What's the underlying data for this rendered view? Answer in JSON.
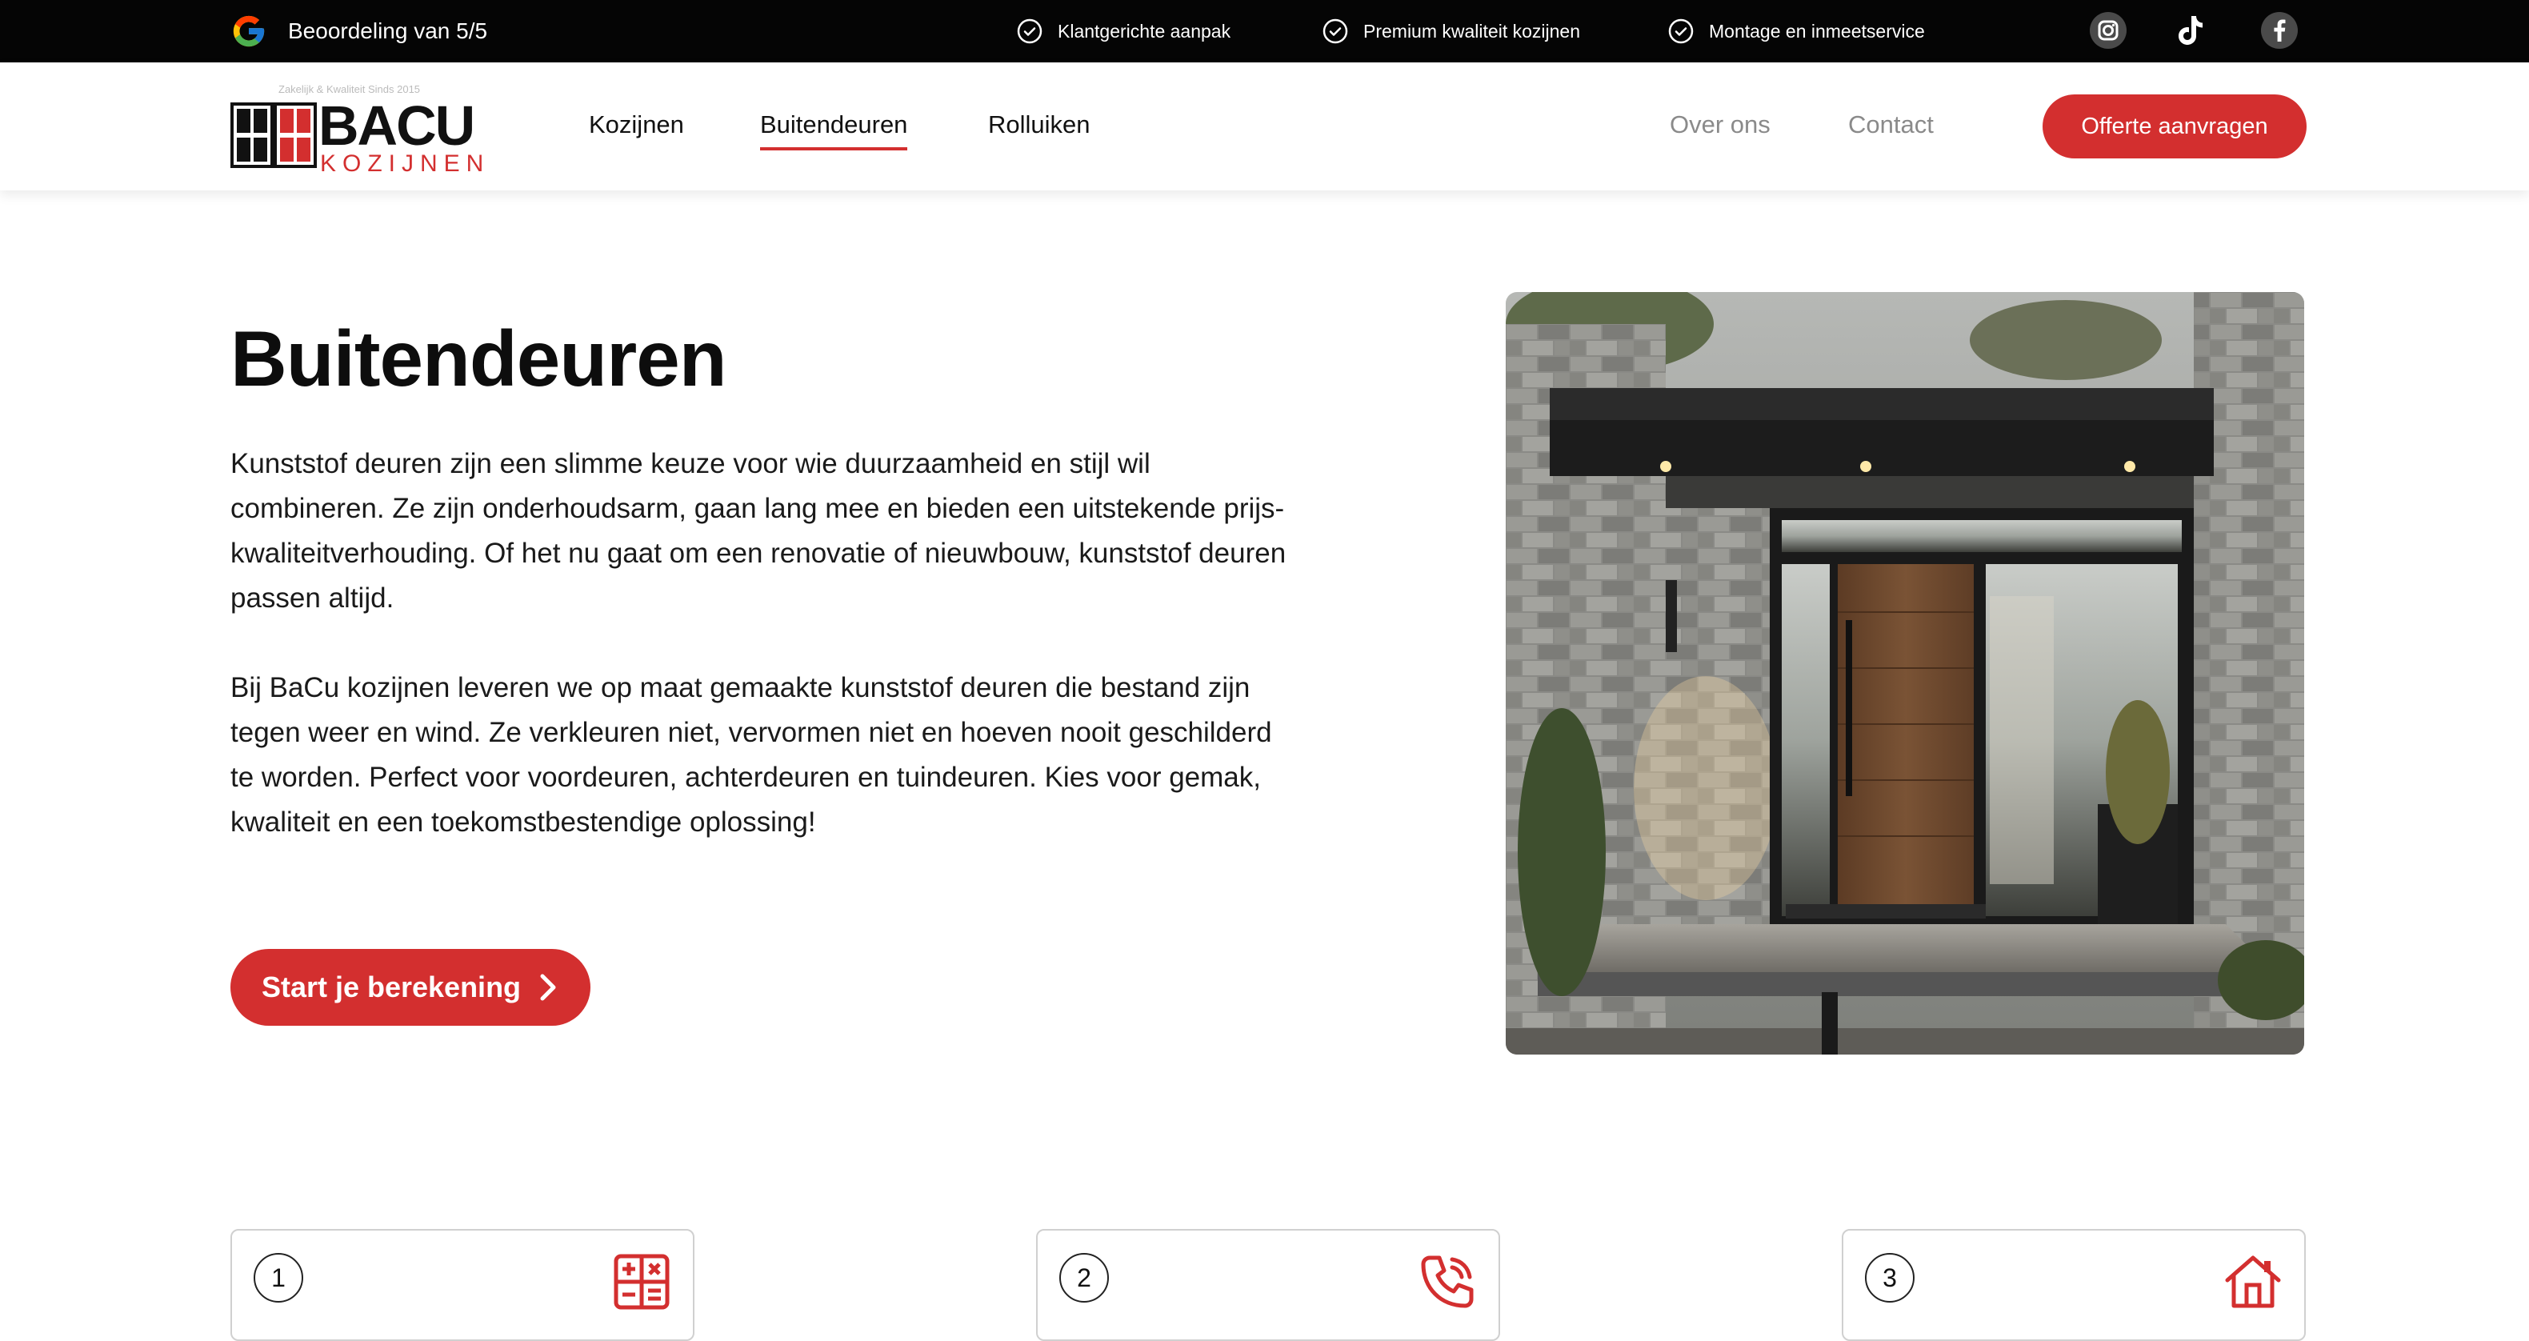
{
  "topbar": {
    "rating_text": "Beoordeling van 5/5",
    "usps": [
      "Klantgerichte aanpak",
      "Premium kwaliteit kozijnen",
      "Montage en inmeetservice"
    ],
    "socials": [
      "instagram-icon",
      "tiktok-icon",
      "facebook-icon"
    ]
  },
  "header": {
    "logo_tagline": "Zakelijk & Kwaliteit Sinds 2015",
    "logo_main": "BACU",
    "logo_sub": "KOZIJNEN",
    "nav": [
      "Kozijnen",
      "Buitendeuren",
      "Rolluiken"
    ],
    "nav_active": "Buitendeuren",
    "nav_right": [
      "Over ons",
      "Contact"
    ],
    "cta": "Offerte aanvragen"
  },
  "hero": {
    "title": "Buitendeuren",
    "paragraph1": "Kunststof deuren zijn een slimme keuze voor wie duurzaamheid en stijl wil combineren. Ze zijn onderhoudsarm, gaan lang mee en bieden een uitstekende prijs-kwaliteitverhouding. Of het nu gaat om een renovatie of nieuwbouw, kunststof deuren passen altijd.",
    "paragraph2": "Bij BaCu kozijnen leveren we op maat gemaakte kunststof deuren die bestand zijn tegen weer en wind. Ze verkleuren niet, vervormen niet en hoeven nooit geschilderd te worden. Perfect voor voordeuren, achterdeuren en tuindeuren. Kies voor gemak, kwaliteit en een toekomstbestendige oplossing!",
    "button": "Start je berekening"
  },
  "steps": [
    {
      "number": "1",
      "icon": "calculator-icon"
    },
    {
      "number": "2",
      "icon": "phone-icon"
    },
    {
      "number": "3",
      "icon": "house-icon"
    }
  ],
  "colors": {
    "accent": "#d32f2f",
    "topbar": "#050505"
  }
}
